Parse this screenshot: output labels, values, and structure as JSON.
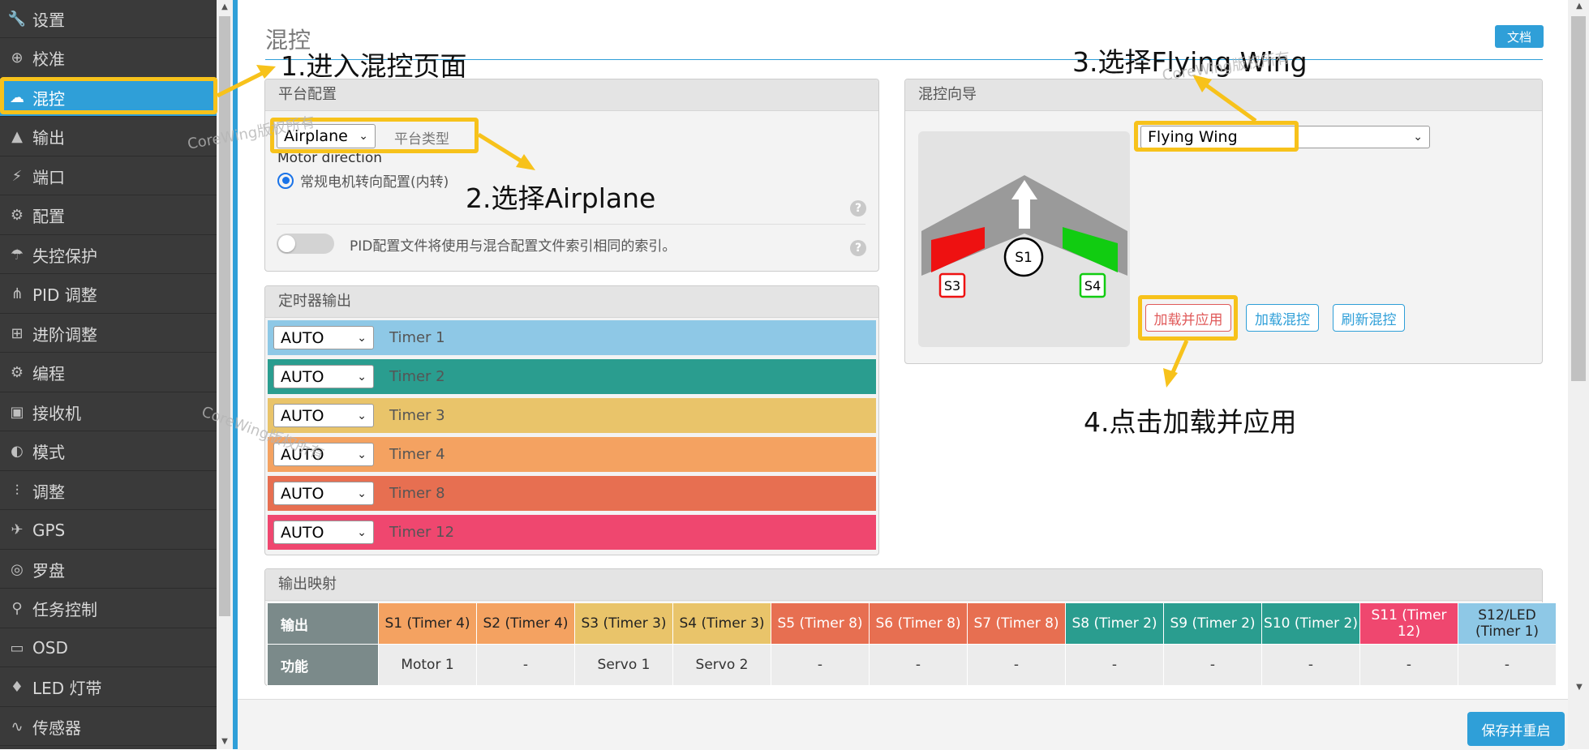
{
  "sidebar": {
    "items": [
      {
        "label": "设置",
        "icon": "wrench-icon"
      },
      {
        "label": "校准",
        "icon": "crosshair-icon"
      },
      {
        "label": "混控",
        "icon": "mixer-icon"
      },
      {
        "label": "输出",
        "icon": "motor-icon"
      },
      {
        "label": "端口",
        "icon": "plug-icon"
      },
      {
        "label": "配置",
        "icon": "gear-icon"
      },
      {
        "label": "失控保护",
        "icon": "parachute-icon"
      },
      {
        "label": "PID 调整",
        "icon": "pid-icon"
      },
      {
        "label": "进阶调整",
        "icon": "advanced-icon"
      },
      {
        "label": "编程",
        "icon": "gear-icon"
      },
      {
        "label": "接收机",
        "icon": "receiver-icon"
      },
      {
        "label": "模式",
        "icon": "toggle-icon"
      },
      {
        "label": "调整",
        "icon": "sliders-icon"
      },
      {
        "label": "GPS",
        "icon": "satellite-icon"
      },
      {
        "label": "罗盘",
        "icon": "compass-icon"
      },
      {
        "label": "任务控制",
        "icon": "map-pin-icon"
      },
      {
        "label": "OSD",
        "icon": "osd-icon"
      },
      {
        "label": "LED 灯带",
        "icon": "led-icon"
      },
      {
        "label": "传感器",
        "icon": "pulse-icon"
      }
    ],
    "active_index": 2
  },
  "header": {
    "title": "混控",
    "doc_button": "文档"
  },
  "platform": {
    "title": "平台配置",
    "platform_select": "Airplane",
    "platform_type_label": "平台类型",
    "motor_direction_label": "Motor direction",
    "motor_direction_option": "常规电机转向配置(内转)",
    "pid_toggle_label": "PID配置文件将使用与混合配置文件索引相同的索引。",
    "help_glyph": "?"
  },
  "timers": {
    "title": "定时器输出",
    "rows": [
      {
        "mode": "AUTO",
        "label": "Timer 1",
        "color": "#8ec8e6"
      },
      {
        "mode": "AUTO",
        "label": "Timer 2",
        "color": "#2a9d8f"
      },
      {
        "mode": "AUTO",
        "label": "Timer 3",
        "color": "#e9c46a"
      },
      {
        "mode": "AUTO",
        "label": "Timer 4",
        "color": "#f4a261"
      },
      {
        "mode": "AUTO",
        "label": "Timer 8",
        "color": "#e76f51"
      },
      {
        "mode": "AUTO",
        "label": "Timer 12",
        "color": "#ef476f"
      }
    ]
  },
  "wizard": {
    "title": "混控向导",
    "preset_select": "Flying Wing",
    "servo_labels": {
      "s1": "S1",
      "s3": "S3",
      "s4": "S4"
    },
    "btn_load_apply": "加载并应用",
    "btn_load": "加载混控",
    "btn_refresh": "刷新混控"
  },
  "output_map": {
    "title": "输出映射",
    "row_header_output": "输出",
    "row_header_function": "功能",
    "columns": [
      {
        "name": "S1 (Timer 4)",
        "function": "Motor 1",
        "color": "#f4a261"
      },
      {
        "name": "S2 (Timer 4)",
        "function": "-",
        "color": "#f4a261"
      },
      {
        "name": "S3 (Timer 3)",
        "function": "Servo 1",
        "color": "#e9c46a"
      },
      {
        "name": "S4 (Timer 3)",
        "function": "Servo 2",
        "color": "#e9c46a"
      },
      {
        "name": "S5 (Timer 8)",
        "function": "-",
        "color": "#e76f51"
      },
      {
        "name": "S6 (Timer 8)",
        "function": "-",
        "color": "#e76f51"
      },
      {
        "name": "S7 (Timer 8)",
        "function": "-",
        "color": "#e76f51"
      },
      {
        "name": "S8 (Timer 2)",
        "function": "-",
        "color": "#2a9d8f"
      },
      {
        "name": "S9 (Timer 2)",
        "function": "-",
        "color": "#2a9d8f"
      },
      {
        "name": "S10 (Timer 2)",
        "function": "-",
        "color": "#2a9d8f"
      },
      {
        "name": "S11 (Timer 12)",
        "function": "-",
        "color": "#ef476f"
      },
      {
        "name": "S12/LED (Timer 1)",
        "function": "-",
        "color": "#8ec8e6"
      }
    ]
  },
  "footer": {
    "save_button": "保存并重启"
  },
  "annotations": {
    "step1": "1.进入混控页面",
    "step2": "2.选择Airplane",
    "step3": "3.选择Flying Wing",
    "step4": "4.点击加载并应用",
    "highlight_color": "#f7c21b"
  },
  "watermark": "CoreWing版权所有"
}
